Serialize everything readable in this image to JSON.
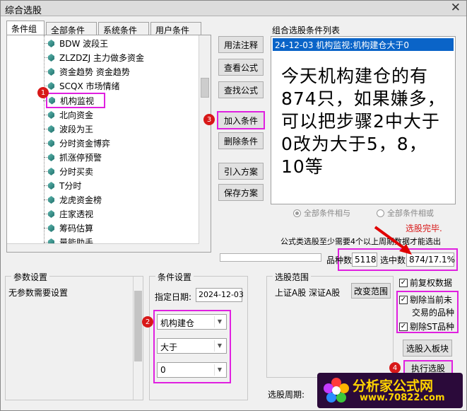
{
  "window": {
    "title": "综合选股",
    "close_glyph": "✕"
  },
  "tabs": [
    {
      "label": "条件组"
    },
    {
      "label": "全部条件"
    },
    {
      "label": "系统条件"
    },
    {
      "label": "用户条件"
    }
  ],
  "tree": {
    "items": [
      {
        "label": "BDW 波段王"
      },
      {
        "label": "ZLZDZJ 主力做多资金"
      },
      {
        "label": "资金趋势 资金趋势"
      },
      {
        "label": "SCQX 市场情绪"
      },
      {
        "label": "机构监视"
      },
      {
        "label": "北向资金"
      },
      {
        "label": "波段为王"
      },
      {
        "label": "分时资金博弈"
      },
      {
        "label": "抓涨停预警"
      },
      {
        "label": "分时买卖"
      },
      {
        "label": "T分时"
      },
      {
        "label": "龙虎资金榜"
      },
      {
        "label": "庄家透视"
      },
      {
        "label": "筹码估算"
      },
      {
        "label": "量能助手"
      }
    ]
  },
  "buttons": {
    "usage": "用法注释",
    "view_formula": "查看公式",
    "find_formula": "查找公式",
    "add_condition": "加入条件",
    "delete_condition": "删除条件",
    "import_plan": "引入方案",
    "save_plan": "保存方案",
    "change_range": "改变范围",
    "to_block": "选股入板块",
    "execute": "执行选股"
  },
  "condition_list": {
    "title": "组合选股条件列表",
    "selected_item": "24-12-03 机构监视:机构建仓大于0",
    "overlay_note": "今天机构建仓的有874只，如果嫌多，可以把步骤2中大于0改为大于5，8，10等"
  },
  "logic": {
    "and_label": "全部条件相与",
    "or_label": "全部条件相或",
    "selected": "and"
  },
  "status": {
    "done": "选股完毕.",
    "hint": "公式类选股至少需要4个以上周期数据才能选出",
    "total_label": "品种数",
    "total_value": "5118",
    "selected_label": "选中数",
    "selected_value": "874/17.1%"
  },
  "params": {
    "title": "参数设置",
    "content": "无参数需要设置"
  },
  "cond_settings": {
    "title": "条件设置",
    "date_label": "指定日期:",
    "date_value": "2024-12-03",
    "field1": "机构建仓",
    "operator": "大于",
    "threshold": "0"
  },
  "range": {
    "title": "选股范围",
    "markets": "上证A股 深证A股"
  },
  "options": {
    "adjusted": {
      "label": "前复权数据",
      "checked": true
    },
    "exclude_suspended": {
      "label": "剔除当前未交易的品种",
      "line1": "剔除当前未",
      "line2": "交易的品种",
      "checked": true
    },
    "exclude_st": {
      "label": "剔除ST品种",
      "checked": true
    }
  },
  "period": {
    "label": "选股周期:"
  },
  "badges": {
    "b1": "1",
    "b2": "2",
    "b3": "3",
    "b4": "4"
  },
  "watermark": {
    "text": "分析家公式网",
    "url": "www.70822.com"
  },
  "colors": {
    "accent_magenta": "#e020e0",
    "selection_blue": "#0a64c8",
    "status_red": "#d81818"
  }
}
